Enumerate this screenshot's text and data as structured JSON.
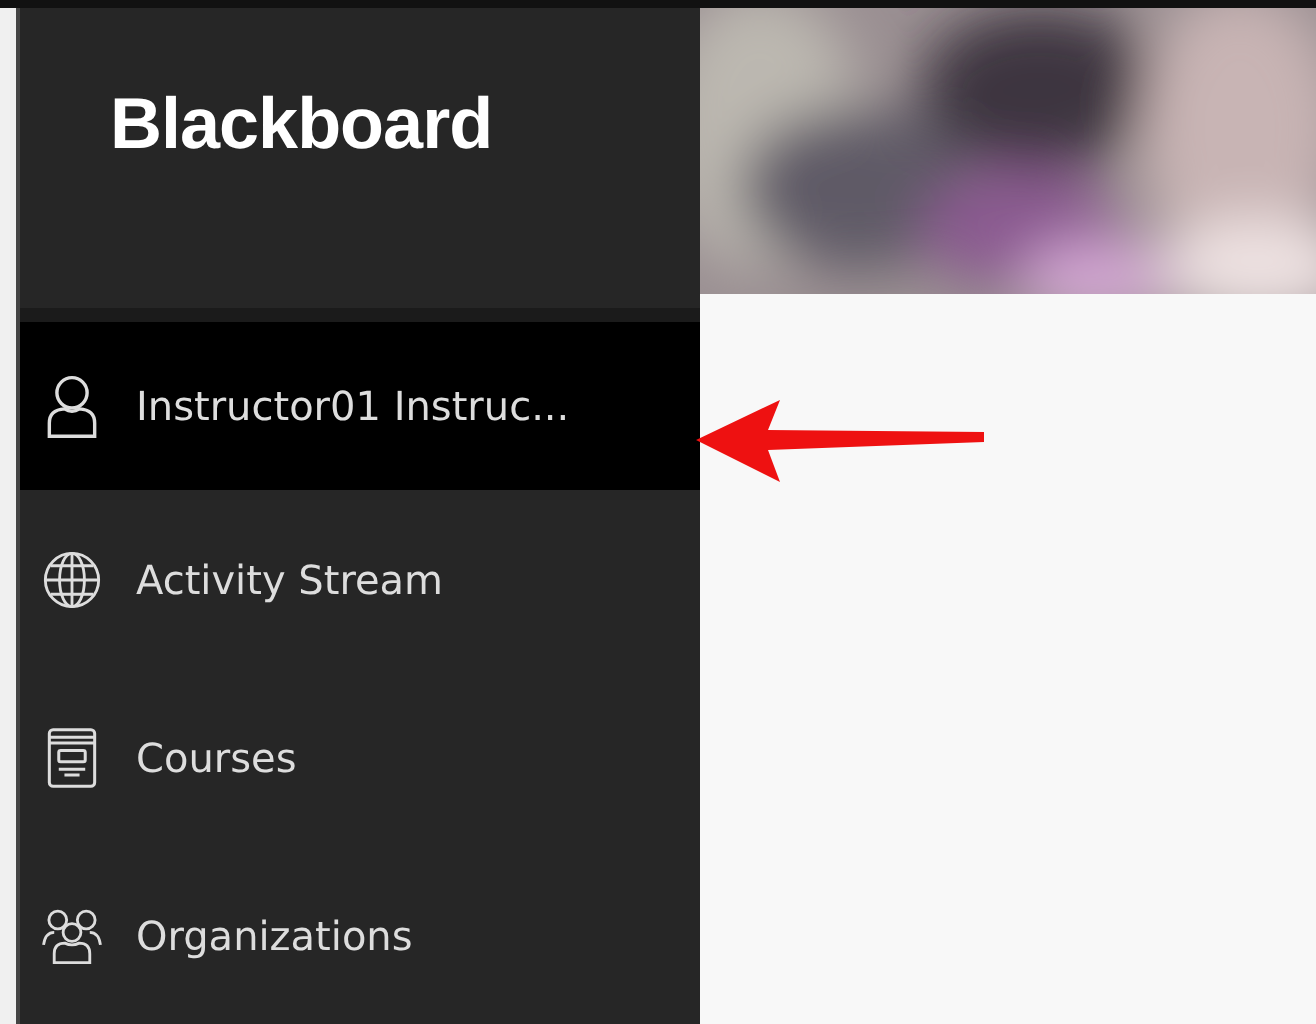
{
  "sidebar": {
    "logo": "Blackboard",
    "items": [
      {
        "label": "Instructor01 Instruc...",
        "selected": true
      },
      {
        "label": "Activity Stream",
        "selected": false
      },
      {
        "label": "Courses",
        "selected": false
      },
      {
        "label": "Organizations",
        "selected": false
      }
    ]
  }
}
